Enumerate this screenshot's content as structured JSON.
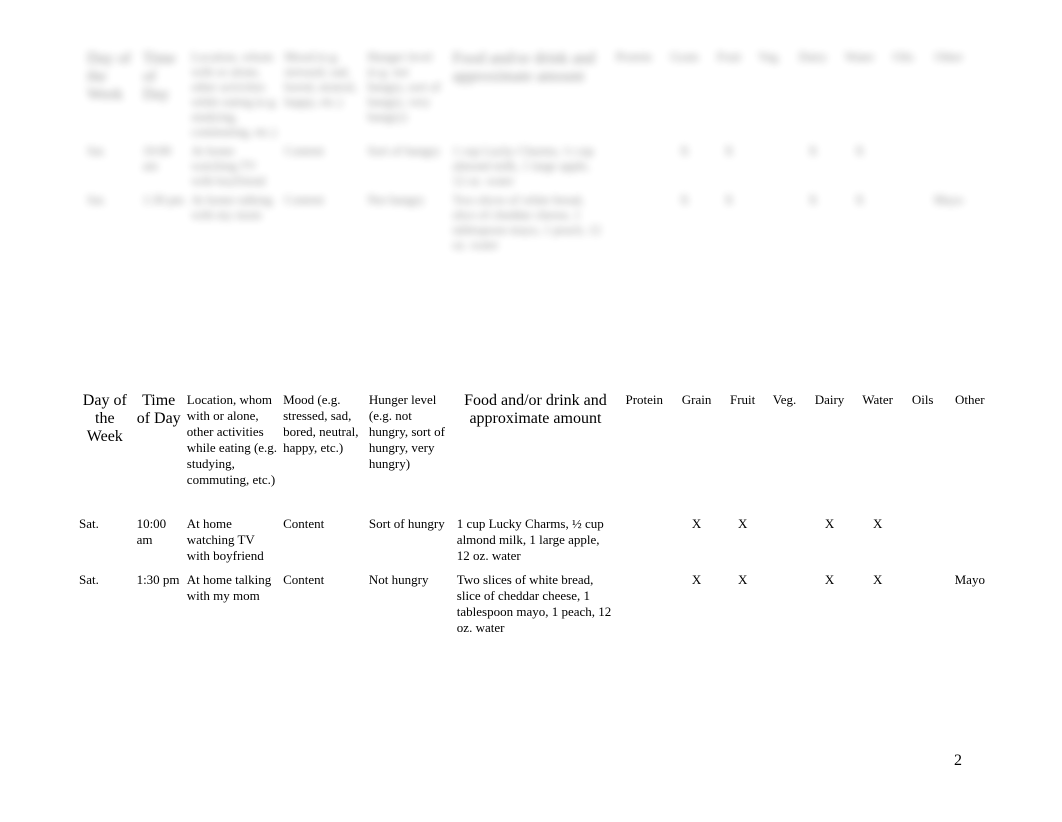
{
  "headers": {
    "day": "Day of the Week",
    "time": "Time of Day",
    "location": "Location, whom with or alone, other activities while eating (e.g. studying, commuting, etc.)",
    "mood": "Mood (e.g. stressed, sad, bored, neutral, happy, etc.)",
    "hunger": "Hunger level (e.g. not hungry, sort of hungry, very hungry)",
    "food": "Food and/or drink and approximate amount",
    "protein": "Protein",
    "grain": "Grain",
    "fruit": "Fruit",
    "veg": "Veg.",
    "dairy": "Dairy",
    "water": "Water",
    "oils": "Oils",
    "other": "Other"
  },
  "rows": [
    {
      "day": "Sat.",
      "time": "10:00 am",
      "location": "At home watching TV with boyfriend",
      "mood": "Content",
      "hunger": "Sort of hungry",
      "food": "1 cup Lucky Charms, ½ cup almond milk, 1 large apple, 12 oz. water",
      "protein": "",
      "grain": "X",
      "fruit": "X",
      "veg": "",
      "dairy": "X",
      "water": "X",
      "oils": "",
      "other": ""
    },
    {
      "day": "Sat.",
      "time": "1:30 pm",
      "location": "At home talking with my mom",
      "mood": "Content",
      "hunger": "Not hungry",
      "food": "Two slices of white bread, slice of cheddar cheese, 1 tablespoon mayo, 1 peach, 12 oz. water",
      "protein": "",
      "grain": "X",
      "fruit": "X",
      "veg": "",
      "dairy": "X",
      "water": "X",
      "oils": "",
      "other": "Mayo"
    }
  ],
  "page_number": "2"
}
